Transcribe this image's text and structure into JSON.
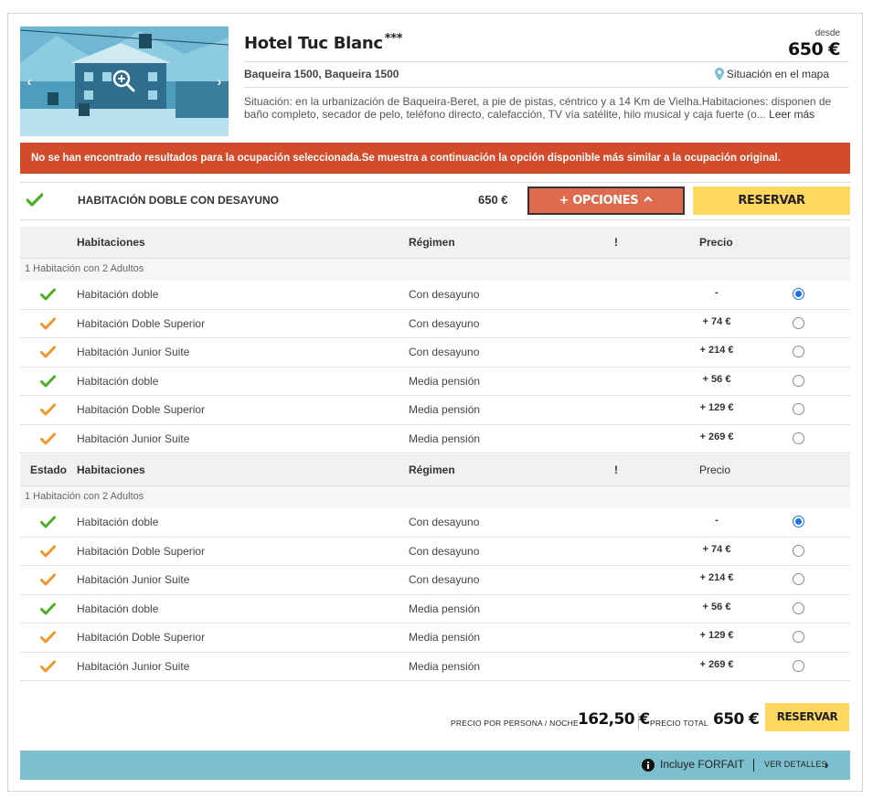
{
  "hotel": {
    "name": "Hotel Tuc Blanc",
    "stars": "***",
    "desde_label": "desde",
    "price_from": "650 €",
    "location": "Baqueira 1500, Baqueira 1500",
    "map_link": "Situación en el mapa",
    "description": "Situación: en la urbanización de Baqueira-Beret, a pie de pistas, céntrico y a 14 Km de Vielha.Habitaciones: disponen de baño completo, secador de pelo, teléfono directo, calefacción, TV vía satélite, hilo musical y caja fuerte (o...",
    "read_more": "Leer más"
  },
  "alert": "No se han encontrado resultados para la ocupación seleccionada.Se muestra a continuación la opción disponible más similar a la ocupación original.",
  "summary": {
    "room": "HABITACIÓN DOBLE CON DESAYUNO",
    "price": "650 €",
    "options_label": "+ OPCIONES",
    "reserve_label": "RESERVAR"
  },
  "tables": [
    {
      "headers": {
        "estado": "",
        "habitaciones": "Habitaciones",
        "regimen": "Régimen",
        "alert": "!",
        "precio": "Precio"
      },
      "group": "1 Habitación con 2 Adultos",
      "rows": [
        {
          "status": "green",
          "room": "Habitación doble",
          "regime": "Con desayuno",
          "price": "-",
          "selected": true
        },
        {
          "status": "orange",
          "room": "Habitación Doble Superior",
          "regime": "Con desayuno",
          "price": "+ 74 €",
          "selected": false
        },
        {
          "status": "orange",
          "room": "Habitación Junior Suite",
          "regime": "Con desayuno",
          "price": "+ 214 €",
          "selected": false
        },
        {
          "status": "green",
          "room": "Habitación doble",
          "regime": "Media pensión",
          "price": "+ 56 €",
          "selected": false
        },
        {
          "status": "orange",
          "room": "Habitación Doble Superior",
          "regime": "Media pensión",
          "price": "+ 129 €",
          "selected": false
        },
        {
          "status": "orange",
          "room": "Habitación Junior Suite",
          "regime": "Media pensión",
          "price": "+ 269 €",
          "selected": false
        }
      ]
    },
    {
      "headers": {
        "estado": "Estado",
        "habitaciones": "Habitaciones",
        "regimen": "Régimen",
        "alert": "!",
        "precio": "Precio"
      },
      "group": "1 Habitación con 2 Adultos",
      "rows": [
        {
          "status": "green",
          "room": "Habitación doble",
          "regime": "Con desayuno",
          "price": "-",
          "selected": true
        },
        {
          "status": "orange",
          "room": "Habitación Doble Superior",
          "regime": "Con desayuno",
          "price": "+ 74 €",
          "selected": false
        },
        {
          "status": "orange",
          "room": "Habitación Junior Suite",
          "regime": "Con desayuno",
          "price": "+ 214 €",
          "selected": false
        },
        {
          "status": "green",
          "room": "Habitación doble",
          "regime": "Media pensión",
          "price": "+ 56 €",
          "selected": false
        },
        {
          "status": "orange",
          "room": "Habitación Doble Superior",
          "regime": "Media pensión",
          "price": "+ 129 €",
          "selected": false
        },
        {
          "status": "orange",
          "room": "Habitación Junior Suite",
          "regime": "Media pensión",
          "price": "+ 269 €",
          "selected": false
        }
      ]
    }
  ],
  "footer": {
    "per_person_label": "PRECIO POR PERSONA / NOCHE",
    "per_person_value": "162,50 €",
    "total_label": "PRECIO TOTAL",
    "total_value": "650 €",
    "reserve_label": "RESERVAR"
  },
  "forfait": {
    "text": "Incluye FORFAIT",
    "details": "VER DETALLES"
  },
  "colors": {
    "alert_bg": "#d24b2a",
    "options_btn": "#df6a4c",
    "reserve_btn": "#ffd85f",
    "forfait_bg": "#7cc0d0",
    "check_green": "#4caf22",
    "check_orange": "#f0962a",
    "radio_selected": "#1a73e8"
  },
  "icons": {
    "status_ok": "check-icon",
    "map": "map-pin-icon",
    "zoom": "zoom-icon",
    "info": "info-icon"
  }
}
